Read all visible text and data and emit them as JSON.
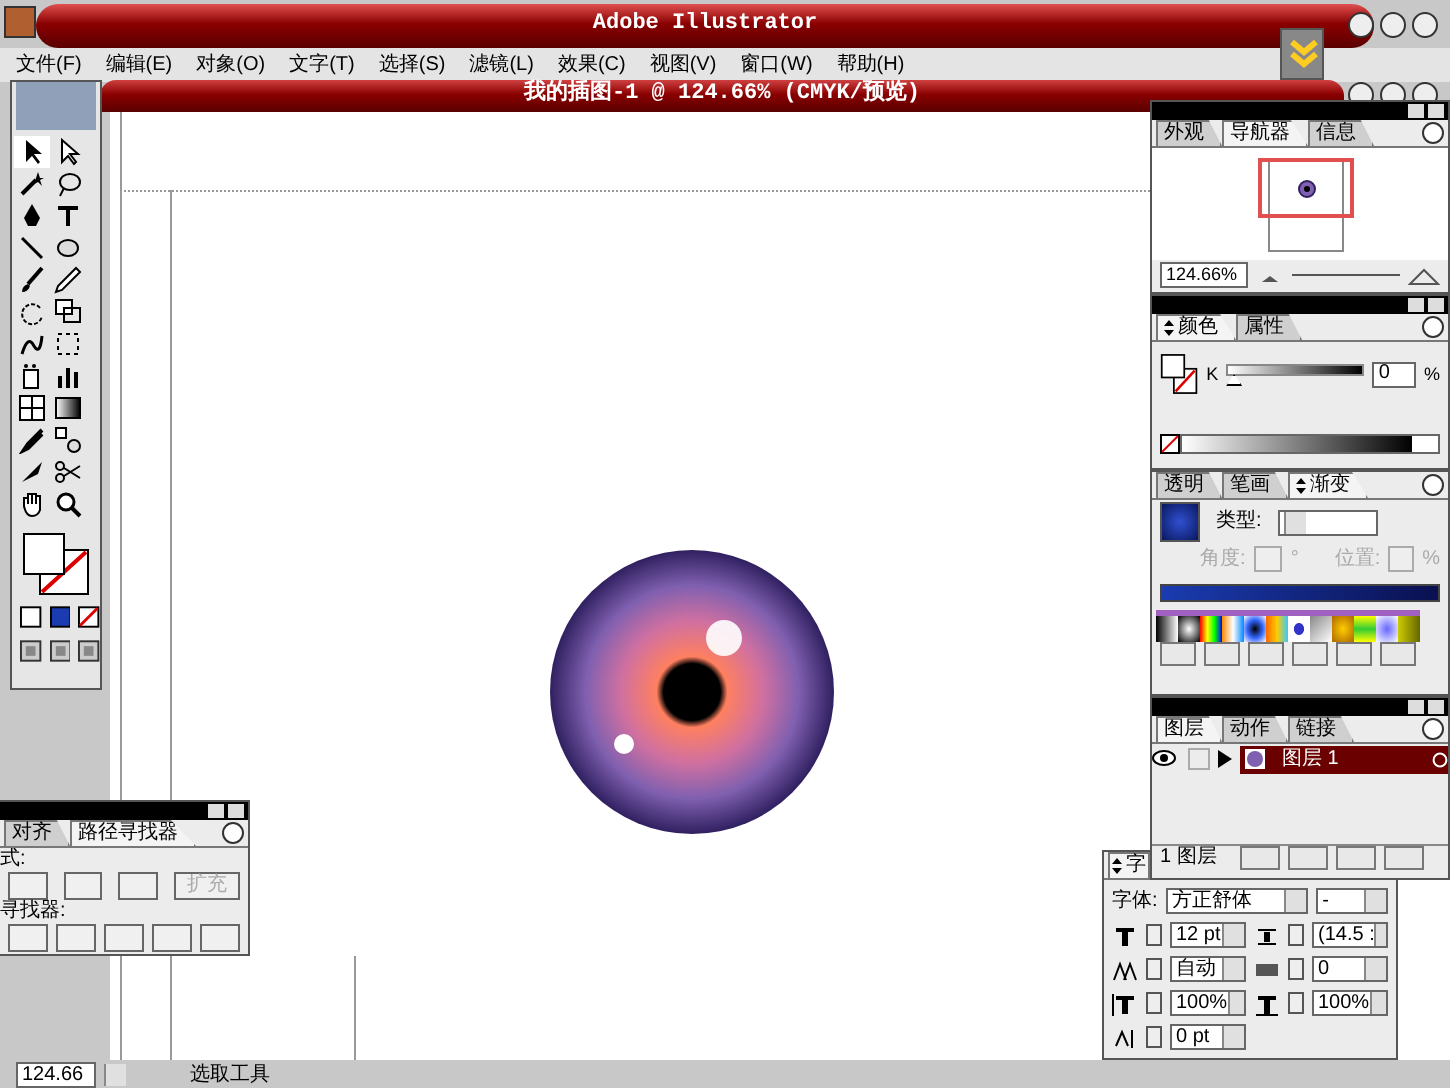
{
  "window": {
    "title": "Adobe Illustrator"
  },
  "menu": [
    "文件(F)",
    "编辑(E)",
    "对象(O)",
    "文字(T)",
    "选择(S)",
    "滤镜(L)",
    "效果(C)",
    "视图(V)",
    "窗口(W)",
    "帮助(H)"
  ],
  "document": {
    "title": "我的插图-1 @ 124.66% (CMYK/预览)"
  },
  "navigator_panel": {
    "tabs": [
      {
        "label": "外观",
        "selected": false,
        "options": false
      },
      {
        "label": "导航器",
        "selected": true,
        "options": false
      },
      {
        "label": "信息",
        "selected": false,
        "options": false
      }
    ],
    "zoom": "124.66%"
  },
  "color_panel": {
    "tabs": [
      {
        "label": "颜色",
        "selected": true,
        "options": true
      },
      {
        "label": "属性",
        "selected": false,
        "options": false
      }
    ],
    "channel": "K",
    "value": "0",
    "unit": "%",
    "level": 0
  },
  "gradient_panel": {
    "tabs": [
      {
        "label": "透明",
        "selected": false,
        "options": false
      },
      {
        "label": "笔画",
        "selected": false,
        "options": false
      },
      {
        "label": "渐变",
        "selected": true,
        "options": true
      }
    ],
    "type_label": "类型:",
    "angle_label": "角度:",
    "angle_unit": "°",
    "location_label": "位置:",
    "location_unit": "%"
  },
  "layers_panel": {
    "tabs": [
      {
        "label": "图层",
        "selected": true,
        "options": false
      },
      {
        "label": "动作",
        "selected": false,
        "options": false
      },
      {
        "label": "链接",
        "selected": false,
        "options": false
      }
    ],
    "layers": [
      {
        "name": "图层 1",
        "visible": true
      }
    ],
    "count": "1 图层"
  },
  "pathfinder_panel": {
    "tabs": [
      {
        "label": "对齐",
        "selected": false,
        "options": false
      },
      {
        "label": "路径寻找器",
        "selected": true,
        "options": false
      }
    ],
    "mode_label": "式:",
    "expand_button": {
      "label": "扩充",
      "disabled": true
    },
    "finder_label": "寻找器:"
  },
  "character_panel": {
    "tab": "字",
    "font_label": "字体:",
    "font": "方正舒体",
    "style": "-",
    "size": "12 pt",
    "leading": "(14.5 :",
    "kerning": "自动",
    "tracking": "0",
    "vscale": "100%",
    "hscale": "100%",
    "baseline": "0 pt"
  },
  "status_bar": {
    "zoom": "124.66",
    "tool": "选取工具"
  }
}
